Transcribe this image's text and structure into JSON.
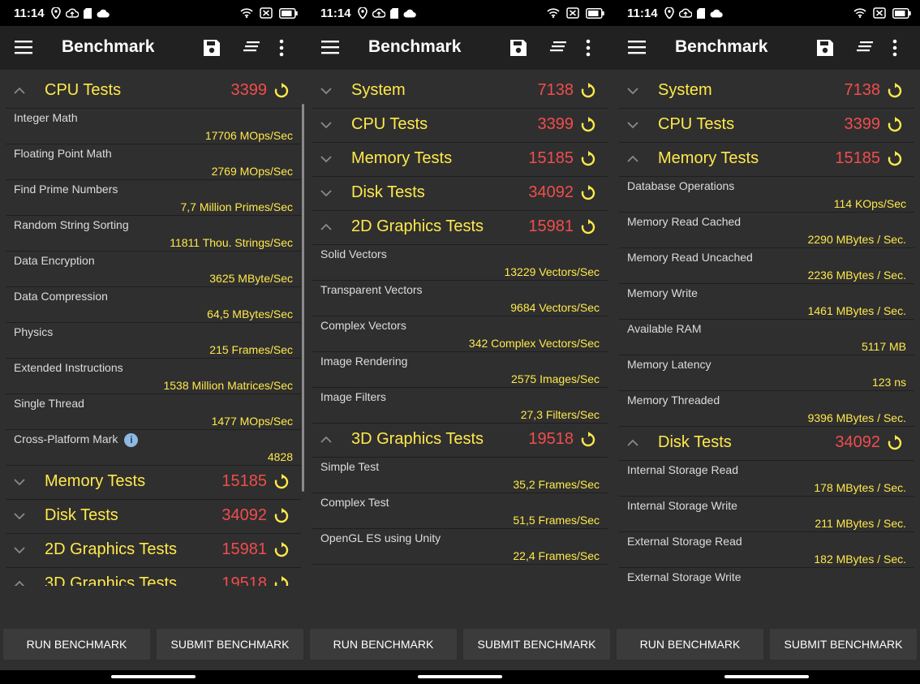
{
  "status_bar": {
    "time": "11:14"
  },
  "app_bar": {
    "title": "Benchmark"
  },
  "buttons": {
    "run": "RUN BENCHMARK",
    "submit": "SUBMIT BENCHMARK"
  },
  "panels": [
    {
      "sections": [
        {
          "label": "CPU Tests",
          "score": "3399",
          "expanded": true,
          "items": [
            {
              "name": "Integer Math",
              "value": "17706 MOps/Sec"
            },
            {
              "name": "Floating Point Math",
              "value": "2769 MOps/Sec"
            },
            {
              "name": "Find Prime Numbers",
              "value": "7,7 Million Primes/Sec"
            },
            {
              "name": "Random String Sorting",
              "value": "11811 Thou. Strings/Sec"
            },
            {
              "name": "Data Encryption",
              "value": "3625 MByte/Sec"
            },
            {
              "name": "Data Compression",
              "value": "64,5 MBytes/Sec"
            },
            {
              "name": "Physics",
              "value": "215 Frames/Sec"
            },
            {
              "name": "Extended Instructions",
              "value": "1538 Million Matrices/Sec"
            },
            {
              "name": "Single Thread",
              "value": "1477 MOps/Sec"
            },
            {
              "name": "Cross-Platform Mark",
              "value": "4828",
              "info": true
            }
          ]
        },
        {
          "label": "Memory Tests",
          "score": "15185",
          "expanded": false,
          "items": []
        },
        {
          "label": "Disk Tests",
          "score": "34092",
          "expanded": false,
          "items": []
        },
        {
          "label": "2D Graphics Tests",
          "score": "15981",
          "expanded": false,
          "items": []
        },
        {
          "label": "3D Graphics Tests",
          "score": "19518",
          "expanded": true,
          "items": []
        }
      ]
    },
    {
      "sections": [
        {
          "label": "System",
          "score": "7138",
          "expanded": false,
          "items": []
        },
        {
          "label": "CPU Tests",
          "score": "3399",
          "expanded": false,
          "items": []
        },
        {
          "label": "Memory Tests",
          "score": "15185",
          "expanded": false,
          "items": []
        },
        {
          "label": "Disk Tests",
          "score": "34092",
          "expanded": false,
          "items": []
        },
        {
          "label": "2D Graphics Tests",
          "score": "15981",
          "expanded": true,
          "items": [
            {
              "name": "Solid Vectors",
              "value": "13229 Vectors/Sec"
            },
            {
              "name": "Transparent Vectors",
              "value": "9684 Vectors/Sec"
            },
            {
              "name": "Complex Vectors",
              "value": "342 Complex Vectors/Sec"
            },
            {
              "name": "Image Rendering",
              "value": "2575 Images/Sec"
            },
            {
              "name": "Image Filters",
              "value": "27,3 Filters/Sec"
            }
          ]
        },
        {
          "label": "3D Graphics Tests",
          "score": "19518",
          "expanded": true,
          "items": [
            {
              "name": "Simple Test",
              "value": "35,2 Frames/Sec"
            },
            {
              "name": "Complex Test",
              "value": "51,5 Frames/Sec"
            },
            {
              "name": "OpenGL ES using Unity",
              "value": "22,4 Frames/Sec"
            }
          ]
        }
      ]
    },
    {
      "sections": [
        {
          "label": "System",
          "score": "7138",
          "expanded": false,
          "items": []
        },
        {
          "label": "CPU Tests",
          "score": "3399",
          "expanded": false,
          "items": []
        },
        {
          "label": "Memory Tests",
          "score": "15185",
          "expanded": true,
          "items": [
            {
              "name": "Database Operations",
              "value": "114 KOps/Sec"
            },
            {
              "name": "Memory Read Cached",
              "value": "2290 MBytes / Sec."
            },
            {
              "name": "Memory Read Uncached",
              "value": "2236 MBytes / Sec."
            },
            {
              "name": "Memory Write",
              "value": "1461 MBytes / Sec."
            },
            {
              "name": "Available RAM",
              "value": "5117 MB"
            },
            {
              "name": "Memory Latency",
              "value": "123 ns"
            },
            {
              "name": "Memory Threaded",
              "value": "9396 MBytes / Sec."
            }
          ]
        },
        {
          "label": "Disk Tests",
          "score": "34092",
          "expanded": true,
          "items": [
            {
              "name": "Internal Storage Read",
              "value": "178 MBytes / Sec."
            },
            {
              "name": "Internal Storage Write",
              "value": "211 MBytes / Sec."
            },
            {
              "name": "External Storage Read",
              "value": "182 MBytes / Sec."
            },
            {
              "name": "External Storage Write",
              "value": ""
            }
          ]
        }
      ]
    }
  ]
}
